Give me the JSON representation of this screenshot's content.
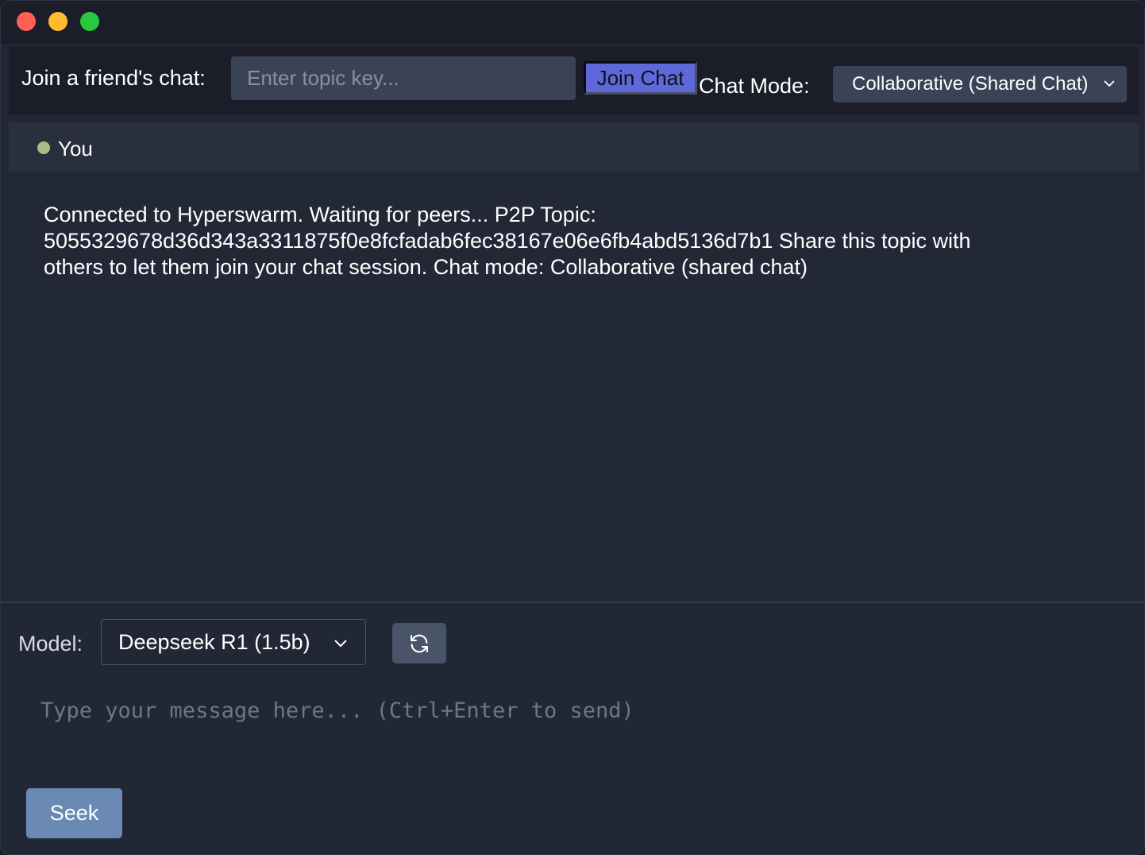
{
  "window": {
    "traffic_lights": [
      "close",
      "minimize",
      "maximize"
    ]
  },
  "topbar": {
    "join_label": "Join a friend's chat:",
    "topic_placeholder": "Enter topic key...",
    "topic_value": "",
    "join_button": "Join Chat",
    "mode_label": "Chat Mode:",
    "mode_selected": "Collaborative (Shared Chat)"
  },
  "chat": {
    "header_user": "You",
    "status_color": "#a3be8c",
    "system_message": "Connected to Hyperswarm. Waiting for peers... P2P Topic: 5055329678d36d343a3311875f0e8fcfadab6fec38167e06e6fb4abd5136d7b1 Share this topic with others to let them join your chat session. Chat mode: Collaborative (shared chat)"
  },
  "composer": {
    "model_label": "Model:",
    "model_selected": "Deepseek R1 (1.5b)",
    "refresh_icon": "refresh-icon",
    "message_placeholder": "Type your message here... (Ctrl+Enter to send)",
    "send_button": "Seek"
  },
  "colors": {
    "accent_join": "#5f68d9",
    "send_button": "#6a89b3",
    "background": "#222735"
  }
}
